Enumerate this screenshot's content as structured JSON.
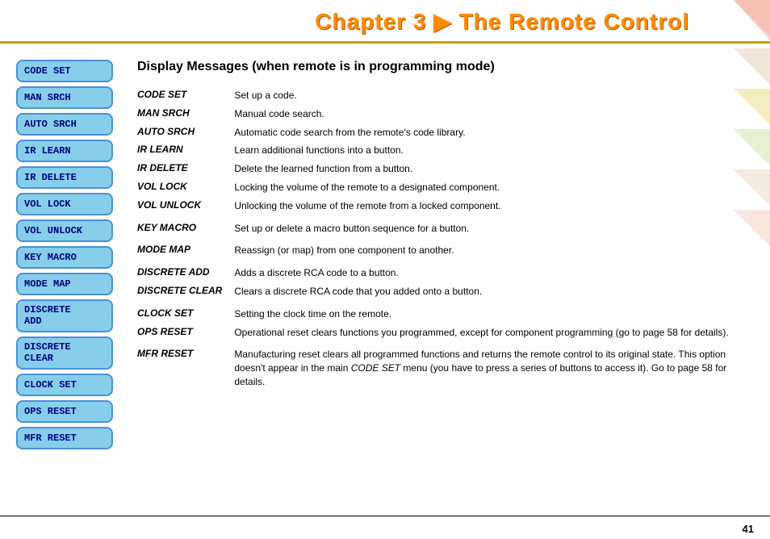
{
  "header": {
    "title": "Chapter 3 ▶ The Remote Control"
  },
  "sidebar": {
    "buttons": [
      {
        "id": "code-set",
        "label": "CODE SET",
        "two_line": false
      },
      {
        "id": "man-srch",
        "label": "MAN SRCH",
        "two_line": false
      },
      {
        "id": "auto-srch",
        "label": "AUTO SRCH",
        "two_line": false
      },
      {
        "id": "ir-learn",
        "label": "IR LEARN",
        "two_line": false
      },
      {
        "id": "ir-delete",
        "label": "IR DELETE",
        "two_line": false
      },
      {
        "id": "vol-lock",
        "label": "VOL LOCK",
        "two_line": false
      },
      {
        "id": "vol-unlock",
        "label": "VOL UNLOCK",
        "two_line": false
      },
      {
        "id": "key-macro",
        "label": "KEY MACRO",
        "two_line": false
      },
      {
        "id": "mode-map",
        "label": "MODE MAP",
        "two_line": false
      },
      {
        "id": "discrete-add",
        "label1": "DISCRETE",
        "label2": "ADD",
        "two_line": true
      },
      {
        "id": "discrete-clear",
        "label1": "DISCRETE",
        "label2": "CLEAR",
        "two_line": true
      },
      {
        "id": "clock-set",
        "label": "CLOCK SET",
        "two_line": false
      },
      {
        "id": "ops-reset",
        "label": "OPS RESET",
        "two_line": false
      },
      {
        "id": "mfr-reset",
        "label": "MFR RESET",
        "two_line": false
      }
    ]
  },
  "content": {
    "title": "Display Messages (when remote is in programming mode)",
    "definitions": [
      {
        "term": "CODE SET",
        "desc": "Set up a code."
      },
      {
        "term": "MAN SRCH",
        "desc": "Manual code search."
      },
      {
        "term": "AUTO SRCH",
        "desc": "Automatic code search from the remote's code library."
      },
      {
        "term": "IR LEARN",
        "desc": "Learn additional functions into a button."
      },
      {
        "term": "IR DELETE",
        "desc": "Delete the learned function from a button."
      },
      {
        "term": "VOL LOCK",
        "desc": "Locking the volume of the remote to a designated component."
      },
      {
        "term": "VOL UNLOCK",
        "desc": "Unlocking the volume of the remote from a locked component."
      },
      {
        "term": "KEY MACRO",
        "desc": "Set up or delete a macro button sequence for a button."
      },
      {
        "term": "MODE MAP",
        "desc": "Reassign (or map) from one component to another."
      },
      {
        "term": "DISCRETE ADD",
        "desc": "Adds a discrete RCA code to a button."
      },
      {
        "term": "DISCRETE CLEAR",
        "desc": "Clears a discrete RCA code that you added onto a button."
      },
      {
        "term": "CLOCK SET",
        "desc": "Setting the clock time on the remote."
      },
      {
        "term": "OPS RESET",
        "desc": "Operational reset clears functions you programmed, except for component programming (go to page 58 for details)."
      },
      {
        "term": "MFR RESET",
        "desc": "Manufacturing reset clears all programmed functions and returns the remote control to its original state. This option doesn't appear in the main CODE SET menu (you have to press a series of buttons to access it). Go to page 58 for details."
      }
    ]
  },
  "footer": {
    "page_number": "41"
  }
}
